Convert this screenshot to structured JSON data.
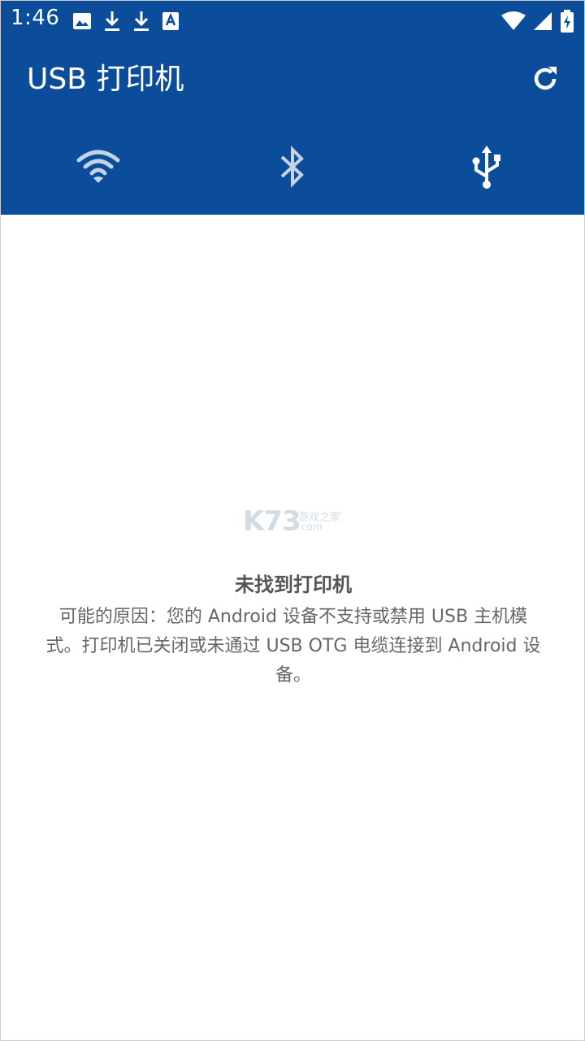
{
  "status_bar": {
    "time": "1:46",
    "left_icons": [
      "image-icon",
      "download-icon",
      "download-icon",
      "app-a-icon"
    ],
    "right_icons": [
      "wifi-signal-icon",
      "cell-signal-icon",
      "battery-charging-icon"
    ]
  },
  "app_bar": {
    "title": "USB 打印机",
    "color": "#0b4d9a",
    "refresh_icon": "refresh-icon"
  },
  "tabs": [
    {
      "icon": "wifi-icon",
      "selected": false
    },
    {
      "icon": "bluetooth-icon",
      "selected": false
    },
    {
      "icon": "usb-icon",
      "selected": true
    }
  ],
  "watermark": {
    "brand": "K73",
    "sub": "游戏之家",
    "domain": ".com"
  },
  "empty_state": {
    "title": "未找到打印机",
    "description": "可能的原因：您的 Android 设备不支持或禁用 USB 主机模式。打印机已关闭或未通过 USB OTG 电缆连接到 Android 设备。"
  }
}
